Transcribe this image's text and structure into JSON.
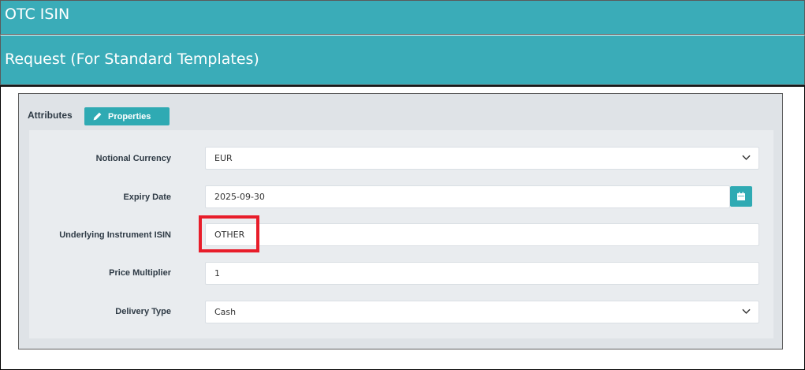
{
  "header": {
    "title": "OTC ISIN",
    "subtitle": "Request (For Standard Templates)"
  },
  "panel": {
    "attributes_label": "Attributes",
    "properties_button": "Properties"
  },
  "form": {
    "notional_currency": {
      "label": "Notional Currency",
      "value": "EUR"
    },
    "expiry_date": {
      "label": "Expiry Date",
      "value": "2025-09-30"
    },
    "underlying_isin": {
      "label": "Underlying Instrument ISIN",
      "value": "OTHER"
    },
    "price_multiplier": {
      "label": "Price Multiplier",
      "value": "1"
    },
    "delivery_type": {
      "label": "Delivery Type",
      "value": "Cash"
    }
  },
  "colors": {
    "header_teal": "#3aacb8",
    "button_teal": "#2faab3",
    "highlight_red": "#e81d2a"
  },
  "icons": [
    "pencil-icon",
    "chevron-down-icon",
    "calendar-icon"
  ]
}
